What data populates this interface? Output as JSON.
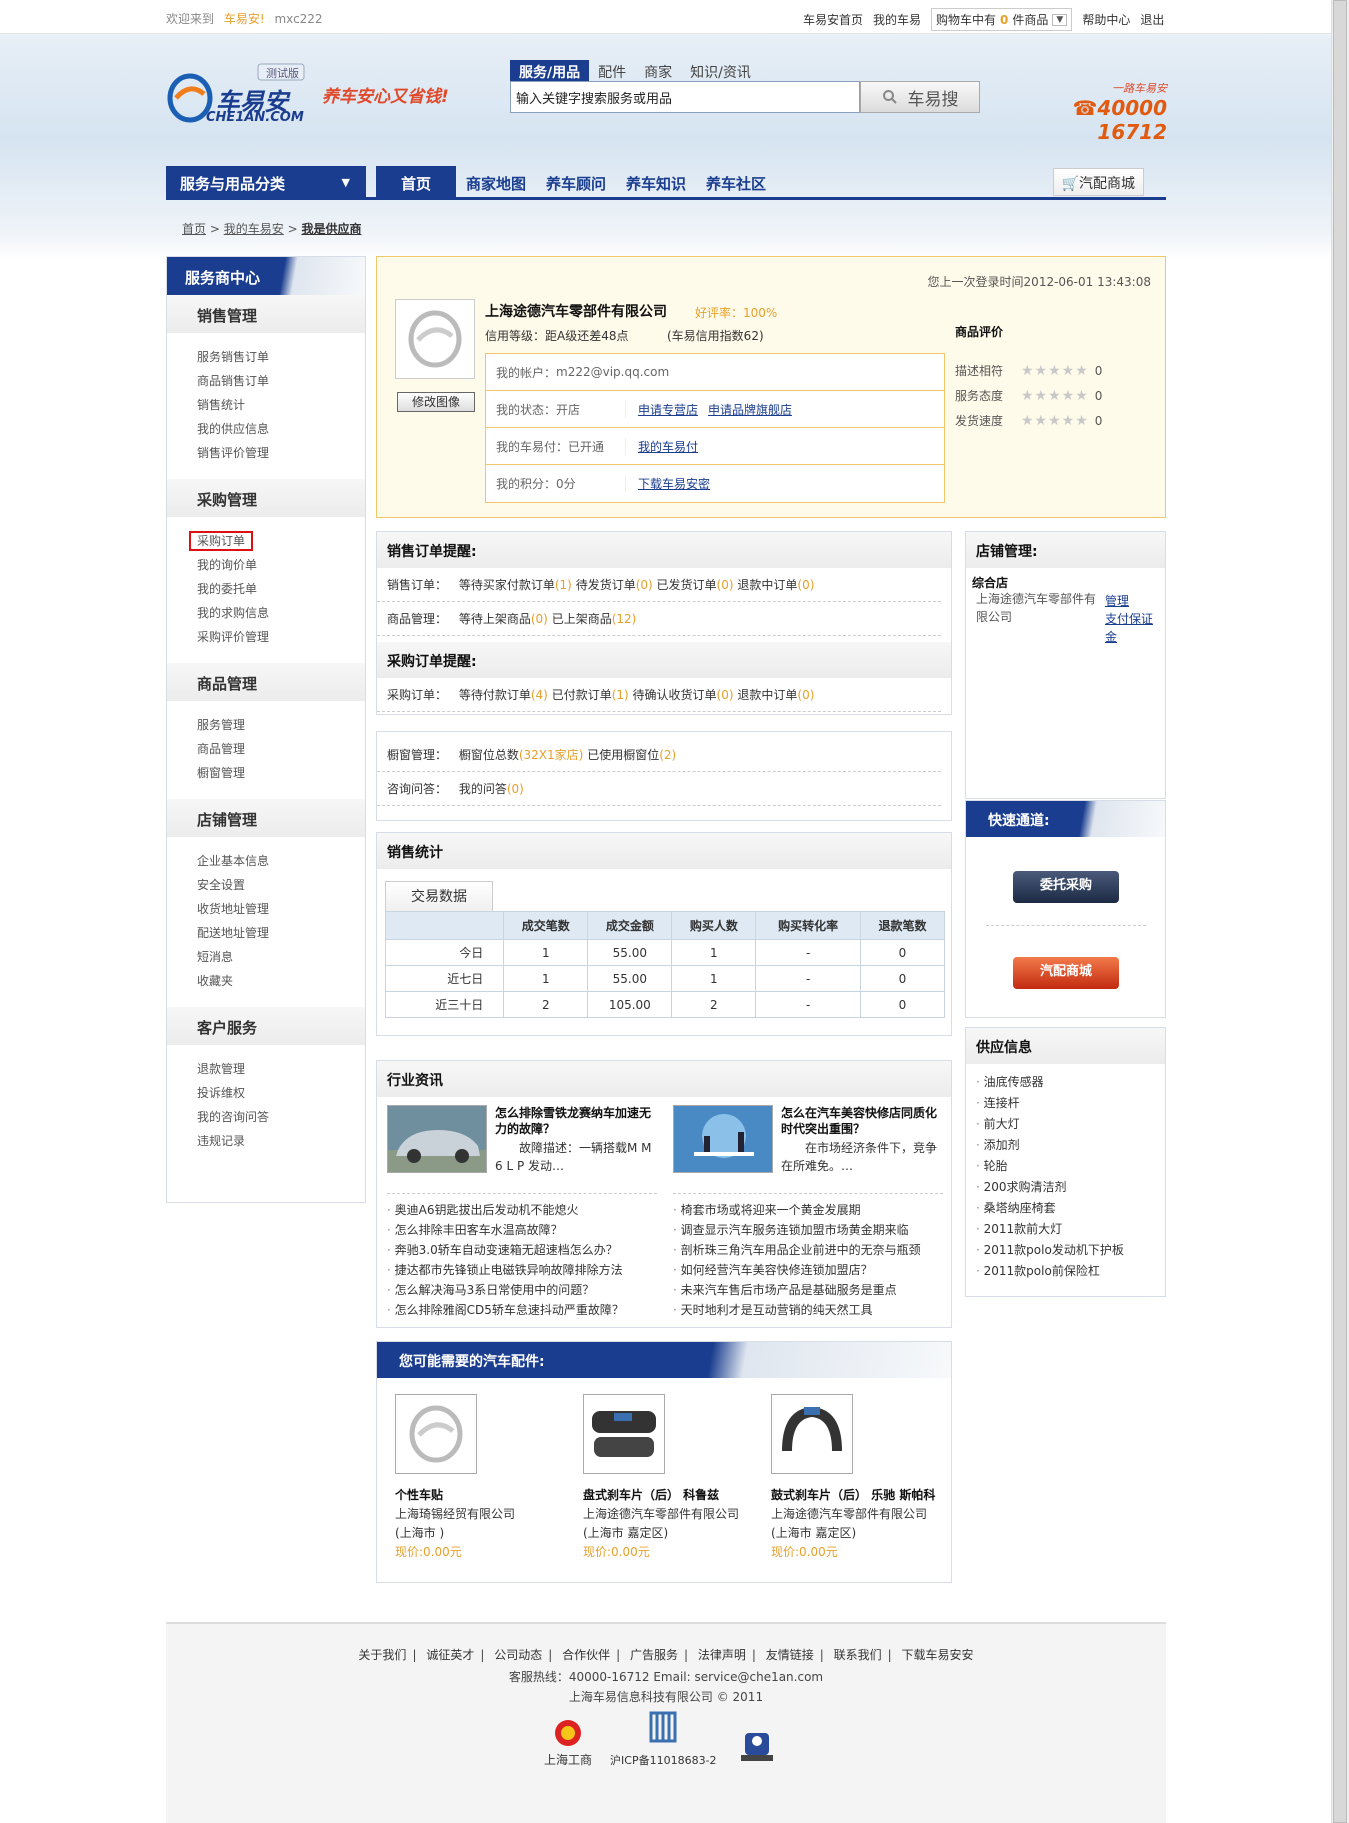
{
  "topbar": {
    "welcome": "欢迎来到",
    "site": "车易安!",
    "user": "mxc222",
    "links": [
      "车易安首页",
      "我的车易"
    ],
    "cart_prefix": "购物车中有",
    "cart_count": "0",
    "cart_suffix": "件商品",
    "help": "帮助中心",
    "logout": "退出"
  },
  "header": {
    "badge": "测试版",
    "logo_cn": "车易安",
    "logo_en": "CHE1AN.COM",
    "slogan": "养车安心又省钱!",
    "search_tabs": [
      "服务/用品",
      "配件",
      "商家",
      "知识/资讯"
    ],
    "search_value": "输入关键字搜索服务或用品",
    "search_btn": "车易搜",
    "hotline_slogan": "一路车易安",
    "hotline": "40000 16712"
  },
  "nav": {
    "category": "服务与用品分类",
    "items": [
      "首页",
      "商家地图",
      "养车顾问",
      "养车知识",
      "养车社区"
    ],
    "mall": "汽配商城"
  },
  "breadcrumb": [
    "首页",
    "我的车易安",
    "我是供应商"
  ],
  "sidebar": {
    "title": "服务商中心",
    "groups": [
      {
        "title": "销售管理",
        "items": [
          "服务销售订单",
          "商品销售订单",
          "销售统计",
          "我的供应信息",
          "销售评价管理"
        ]
      },
      {
        "title": "采购管理",
        "items": [
          "采购订单",
          "我的询价单",
          "我的委托单",
          "我的求购信息",
          "采购评价管理"
        ]
      },
      {
        "title": "商品管理",
        "items": [
          "服务管理",
          "商品管理",
          "橱窗管理"
        ]
      },
      {
        "title": "店铺管理",
        "items": [
          "企业基本信息",
          "安全设置",
          "收货地址管理",
          "配送地址管理",
          "短消息",
          "收藏夹"
        ]
      },
      {
        "title": "客户服务",
        "items": [
          "退款管理",
          "投诉维权",
          "我的咨询问答",
          "违规记录"
        ]
      }
    ]
  },
  "info": {
    "last_login": "您上一次登录时间2012-06-01 13:43:08",
    "company": "上海途德汽车零部件有限公司",
    "rate": "好评率：100%",
    "credit": "信用等级：距A级还差48点",
    "credit_idx": "(车易信用指数62)",
    "edit_avatar": "修改图像",
    "account_label": "我的帐户：",
    "account": "m222@vip.qq.com",
    "status_label": "我的状态：开店",
    "status_links": [
      "申请专营店",
      "申请品牌旗舰店"
    ],
    "pay_label": "我的车易付：已开通",
    "pay_link": "我的车易付",
    "points_label": "我的积分：0分",
    "points_link": "下载车易安密",
    "eval_title": "商品评价",
    "evals": [
      {
        "k": "描述相符",
        "v": "0"
      },
      {
        "k": "服务态度",
        "v": "0"
      },
      {
        "k": "发货速度",
        "v": "0"
      }
    ]
  },
  "reminders": {
    "sales_title": "销售订单提醒:",
    "sales_order_label": "销售订单：",
    "sales_order": [
      {
        "t": "等待买家付款订单",
        "n": "(1)"
      },
      {
        "t": "待发货订单",
        "n": "(0)"
      },
      {
        "t": "已发货订单",
        "n": "(0)"
      },
      {
        "t": "退款中订单",
        "n": "(0)"
      }
    ],
    "goods_label": "商品管理：",
    "goods": [
      {
        "t": "等待上架商品",
        "n": "(0)"
      },
      {
        "t": "已上架商品",
        "n": "(12)"
      }
    ],
    "purchase_title": "采购订单提醒:",
    "purchase_label": "采购订单：",
    "purchase": [
      {
        "t": "等待付款订单",
        "n": "(4)"
      },
      {
        "t": "已付款订单",
        "n": "(1)"
      },
      {
        "t": "待确认收货订单",
        "n": "(0)"
      },
      {
        "t": "退款中订单",
        "n": "(0)"
      }
    ]
  },
  "window_box": {
    "window_label": "橱窗管理：",
    "window_total": "橱窗位总数",
    "window_total_n": "(32X1家店)",
    "window_used": "已使用橱窗位",
    "window_used_n": "(2)",
    "qa_label": "咨询问答：",
    "qa": "我的问答",
    "qa_n": "(0)"
  },
  "stats": {
    "title": "销售统计",
    "tab": "交易数据",
    "columns": [
      "",
      "成交笔数",
      "成交金额",
      "购买人数",
      "购买转化率",
      "退款笔数"
    ],
    "rows": [
      [
        "今日",
        "1",
        "55.00",
        "1",
        "-",
        "0"
      ],
      [
        "近七日",
        "1",
        "55.00",
        "1",
        "-",
        "0"
      ],
      [
        "近三十日",
        "2",
        "105.00",
        "2",
        "-",
        "0"
      ]
    ]
  },
  "news": {
    "title": "行业资讯",
    "left": {
      "headline": "怎么排除雪铁龙赛纳车加速无力的故障？",
      "desc": "故障描述：一辆搭载M M 6 L P 发动…",
      "list": [
        "奥迪A6钥匙拔出后发动机不能熄火",
        "怎么排除丰田客车水温高故障？",
        "奔驰3.0轿车自动变速箱无超速档怎么办？",
        "捷达都市先锋锁止电磁铁异响故障排除方法",
        "怎么解决海马3系日常使用中的问题？",
        "怎么排除雅阁CD5轿车怠速抖动严重故障？"
      ]
    },
    "right": {
      "headline": "怎么在汽车美容快修店同质化时代突出重围？",
      "desc": "在市场经济条件下，竞争在所难免。…",
      "list": [
        "椅套市场或将迎来一个黄金发展期",
        "调查显示汽车服务连锁加盟市场黄金期来临",
        "剖析珠三角汽车用品企业前进中的无奈与瓶颈",
        "如何经营汽车美容快修连锁加盟店？",
        "未来汽车售后市场产品是基础服务是重点",
        "天时地利才是互动营销的纯天然工具"
      ]
    }
  },
  "parts": {
    "title": "您可能需要的汽车配件:",
    "items": [
      {
        "name": "个性车贴",
        "supplier": "上海琦锡经贸有限公司",
        "loc": "(上海市 )",
        "price": "现价:0.00元"
      },
      {
        "name": "盘式刹车片（后） 科鲁兹",
        "supplier": "上海途德汽车零部件有限公司",
        "loc": "(上海市 嘉定区)",
        "price": "现价:0.00元"
      },
      {
        "name": "鼓式刹车片（后） 乐驰 斯帕科",
        "supplier": "上海途德汽车零部件有限公司",
        "loc": "(上海市 嘉定区)",
        "price": "现价:0.00元"
      }
    ]
  },
  "shop": {
    "title": "店铺管理:",
    "type": "综合店",
    "name": "上海途德汽车零部件有限公司",
    "manage": "管理",
    "deposit": "支付保证金"
  },
  "quick": {
    "title": "快速通道:",
    "btn1": "委托采购",
    "btn2": "汽配商城"
  },
  "supply": {
    "title": "供应信息",
    "items": [
      "油底传感器",
      "连接杆",
      "前大灯",
      "添加剂",
      "轮胎",
      "200求购清洁剂",
      "桑塔纳座椅套",
      "2011款前大灯",
      "2011款polo发动机下护板",
      "2011款polo前保险杠"
    ]
  },
  "footer": {
    "links": [
      "关于我们",
      "诚征英才",
      "公司动态",
      "合作伙伴",
      "广告服务",
      "法律声明",
      "友情链接",
      "联系我们",
      "下载车易安安"
    ],
    "hotline": "客服热线：40000-16712 Email: service@che1an.com",
    "copy": "上海车易信息科技有限公司 © 2011",
    "badge1": "上海工商",
    "badge2": "沪ICP备11018683-2"
  }
}
